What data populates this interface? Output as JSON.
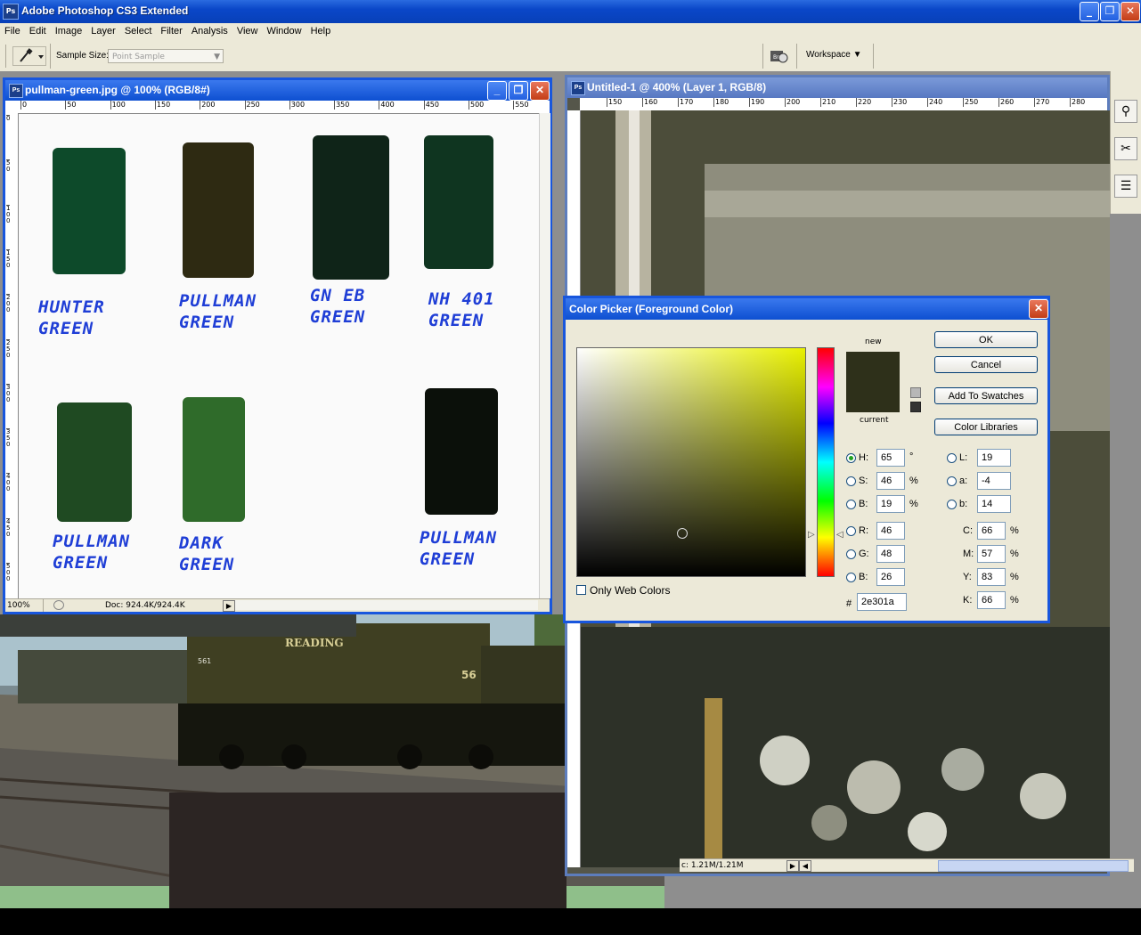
{
  "app": {
    "title": "Adobe Photoshop CS3 Extended",
    "icon": "ps-icon"
  },
  "menu": [
    "File",
    "Edit",
    "Image",
    "Layer",
    "Select",
    "Filter",
    "Analysis",
    "View",
    "Window",
    "Help"
  ],
  "options_bar": {
    "tool_icon": "eyedropper-icon",
    "sample_size_label": "Sample Size:",
    "sample_size_value": "Point Sample",
    "workspace_label": "Workspace"
  },
  "doc1": {
    "title": "pullman-green.jpg @ 100% (RGB/8#)",
    "ruler_h": [
      "0",
      "50",
      "100",
      "150",
      "200",
      "250",
      "300",
      "350",
      "400",
      "450",
      "500",
      "550"
    ],
    "ruler_v": [
      "0",
      "5\n0",
      "1\n0\n0",
      "1\n5\n0",
      "2\n0\n0",
      "2\n5\n0",
      "3\n0\n0",
      "3\n5\n0",
      "4\n0\n0",
      "4\n5\n0",
      "5\n0\n0",
      "5\n5\n0"
    ],
    "samples": [
      {
        "line1": "HUNTER",
        "line2": "GREEN",
        "color": "#0d4a2a"
      },
      {
        "line1": "PULLMAN",
        "line2": "GREEN",
        "color": "#2e2a12"
      },
      {
        "line1": "GN EB",
        "line2": "GREEN",
        "color": "#0f2418"
      },
      {
        "line1": "NH 401",
        "line2": "GREEN",
        "color": "#0f3520"
      },
      {
        "line1": "PULLMAN",
        "line2": "GREEN",
        "color": "#1f4a22"
      },
      {
        "line1": "DARK",
        "line2": "GREEN",
        "color": "#2f6b2a"
      },
      {
        "line1": "PULLMAN",
        "line2": "GREEN",
        "color": "#0b100a"
      }
    ],
    "zoom": "100%",
    "doc_size": "Doc: 924.4K/924.4K"
  },
  "doc2": {
    "title": "Untitled-1 @ 400% (Layer 1, RGB/8)",
    "ruler_h": [
      "150",
      "160",
      "170",
      "180",
      "190",
      "200",
      "210",
      "220",
      "230",
      "240",
      "250",
      "260",
      "270",
      "280"
    ],
    "status": "c: 1.21M/1.21M"
  },
  "photo": {
    "loco_lettering": "READING",
    "loco_number": "56",
    "car_number": "561"
  },
  "picker": {
    "title": "Color Picker (Foreground Color)",
    "new_label": "new",
    "current_label": "current",
    "new_color": "#2e301a",
    "current_color": "#2e301a",
    "ok": "OK",
    "cancel": "Cancel",
    "add_swatches": "Add To Swatches",
    "color_libraries": "Color Libraries",
    "only_web": "Only Web Colors",
    "hsb": {
      "H": "65",
      "S": "46",
      "B": "19"
    },
    "hsb_units": {
      "H": "°",
      "S": "%",
      "B": "%"
    },
    "rgb": {
      "R": "46",
      "G": "48",
      "B": "26"
    },
    "lab": {
      "L": "19",
      "a": "-4",
      "b": "14"
    },
    "cmyk": {
      "C": "66",
      "M": "57",
      "Y": "83",
      "K": "66"
    },
    "hex": "2e301a",
    "hue_gradient_color": "#e8f000"
  }
}
